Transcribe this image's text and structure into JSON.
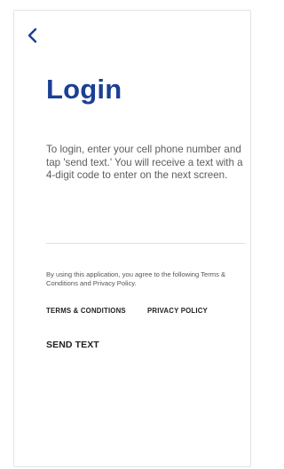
{
  "nav": {
    "back_icon": "chevron-left-icon"
  },
  "login": {
    "title": "Login",
    "instructions": "To login, enter your cell phone number and tap 'send text.' You will receive a text with a 4-digit code to enter on the next screen.",
    "phone_value": "",
    "phone_placeholder": ""
  },
  "legal": {
    "agreement_text": "By using this application, you agree to the following Terms & Conditions and Privacy Policy.",
    "terms_label": "TERMS & CONDITIONS",
    "privacy_label": "PRIVACY POLICY"
  },
  "actions": {
    "send_text_label": "SEND TEXT"
  },
  "colors": {
    "accent": "#1b3f95",
    "body_text": "#5d5d5d",
    "divider": "#e1e1e1"
  }
}
